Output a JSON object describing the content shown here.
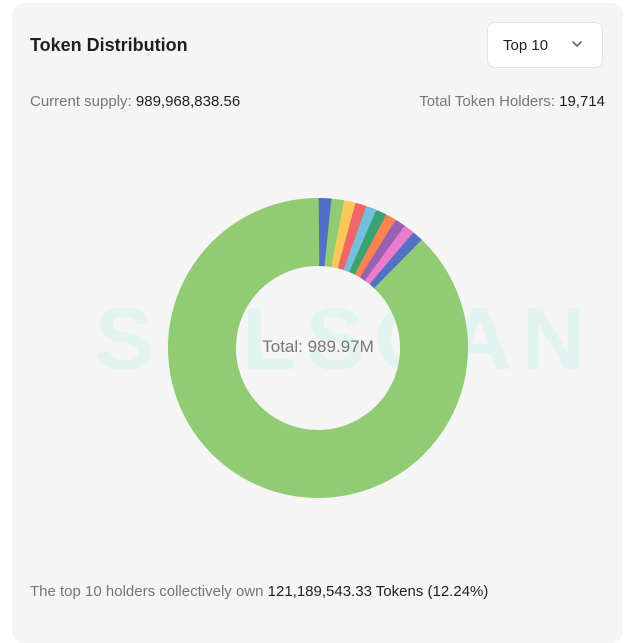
{
  "card": {
    "title": "Token Distribution",
    "dropdown": {
      "selected": "Top 10",
      "icon": "chevron-down-icon"
    },
    "supply": {
      "label": "Current supply: ",
      "value": "989,968,838.56"
    },
    "holders": {
      "label": "Total Token Holders: ",
      "value": "19,714"
    },
    "watermark": "SOLSCAN",
    "center_label": "Total: 989.97M",
    "footer": {
      "prefix": "The top 10 holders collectively own ",
      "value": "121,189,543.33 Tokens (12.24%)"
    }
  },
  "chart_data": {
    "type": "pie",
    "donut": true,
    "total_label": "Total: 989.97M",
    "segments": [
      {
        "color": "#5470c6",
        "value": 1.5
      },
      {
        "color": "#91cc75",
        "value": 1.35
      },
      {
        "color": "#fac858",
        "value": 1.25
      },
      {
        "color": "#ee6666",
        "value": 1.2
      },
      {
        "color": "#73c0de",
        "value": 1.15
      },
      {
        "color": "#3ba272",
        "value": 1.15
      },
      {
        "color": "#fc8452",
        "value": 1.15
      },
      {
        "color": "#9a60b4",
        "value": 1.15
      },
      {
        "color": "#ea7ccc",
        "value": 1.15
      },
      {
        "color": "#5470c6",
        "value": 1.19
      },
      {
        "color": "#91cc75",
        "value": 87.76
      }
    ]
  }
}
